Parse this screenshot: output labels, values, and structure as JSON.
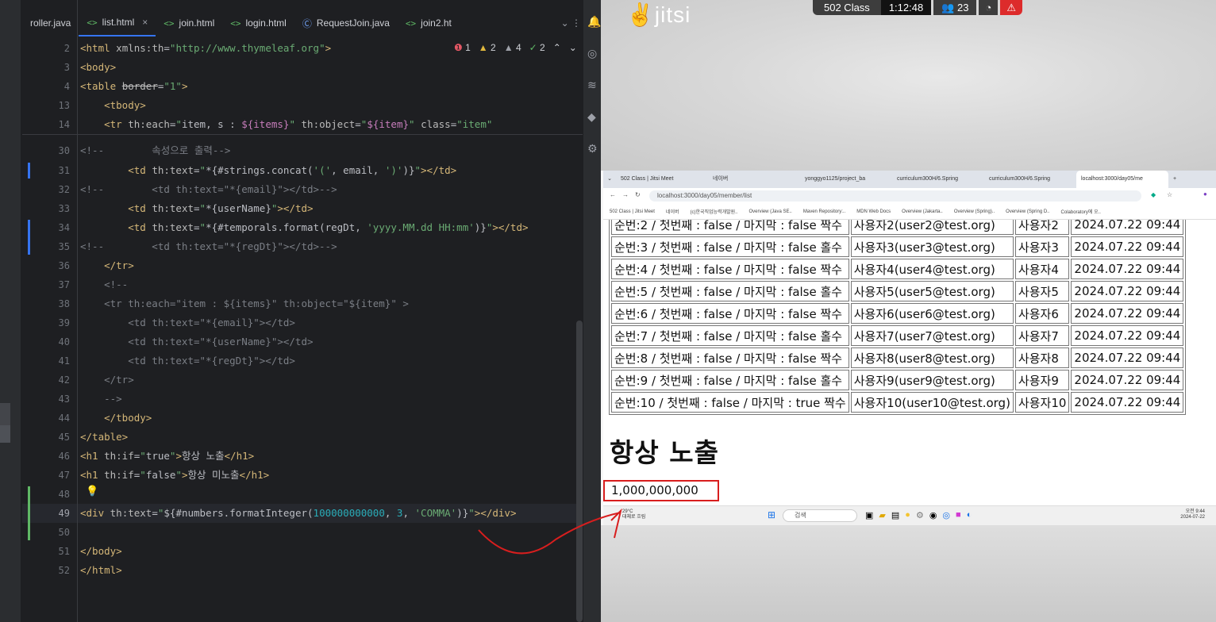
{
  "ide": {
    "tabs": [
      {
        "label": "roller.java",
        "icon": "java-class-icon",
        "closable": false
      },
      {
        "label": "list.html",
        "icon": "html-file-icon",
        "closable": true,
        "active": true
      },
      {
        "label": "join.html",
        "icon": "html-file-icon",
        "closable": false
      },
      {
        "label": "login.html",
        "icon": "html-file-icon",
        "closable": false
      },
      {
        "label": "RequestJoin.java",
        "icon": "java-class-icon",
        "closable": false
      },
      {
        "label": "join2.ht",
        "icon": "html-file-icon",
        "closable": false
      }
    ],
    "inspections": {
      "errors": "1",
      "warnings": "2",
      "weak_warnings": "4",
      "ok": "2"
    },
    "line_numbers": [
      "2",
      "3",
      "4",
      "13",
      "14",
      "30",
      "31",
      "32",
      "33",
      "34",
      "35",
      "36",
      "37",
      "38",
      "39",
      "40",
      "41",
      "42",
      "43",
      "44",
      "45",
      "46",
      "47",
      "48",
      "49",
      "50",
      "51",
      "52"
    ],
    "code": {
      "l2": "<html xmlns:th=\"http://www.thymeleaf.org\">",
      "l3": "<body>",
      "l4": "<table border=\"1\">",
      "l13": "<tbody>",
      "l14": "<tr th:each=\"item, s : ${items}\" th:object=\"${item}\" class=\"item\"",
      "l30": "<!--        속성으로 출력-->",
      "l31": "<td th:text=\"*{#strings.concat('(', email, ')')}\"></td>",
      "l32": "<!--        <td th:text=\"*{email}\"></td>-->",
      "l33": "<td th:text=\"*{userName}\"></td>",
      "l34": "<td th:text=\"*{#temporals.format(regDt, 'yyyy.MM.dd HH:mm')}\"></td>",
      "l35": "<!--        <td th:text=\"*{regDt}\"></td>-->",
      "l36": "</tr>",
      "l37": "<!--",
      "l38": "<tr th:each=\"item : ${items}\" th:object=\"${item}\" >",
      "l39": "<td th:text=\"*{email}\"></td>",
      "l40": "<td th:text=\"*{userName}\"></td>",
      "l41": "<td th:text=\"*{regDt}\"></td>",
      "l42": "</tr>",
      "l43": "-->",
      "l44": "</tbody>",
      "l45": "</table>",
      "l46": "<h1 th:if=\"true\">항상 노출</h1>",
      "l47": "<h1 th:if=\"false\">항상 미노출</h1>",
      "l49": "<div th:text=\"${#numbers.formatInteger(100000000000, 3, 'COMMA')}\"></div>",
      "l51": "</body>",
      "l52": "</html>"
    }
  },
  "meeting": {
    "logo": "jitsi",
    "room": "502 Class",
    "duration": "1:12:48",
    "participants": "23"
  },
  "browser": {
    "tabs": [
      "502 Class | Jitsi Meet",
      "네이버",
      "yonggyo1125/project_ba",
      "curriculum300H/6.Spring",
      "curriculum300H/6.Spring",
      "localhost:3000/day05/me"
    ],
    "url": "localhost:3000/day05/member/list",
    "bookmarks": [
      "502 Class | Jitsi Meet",
      "네이버",
      "(c)한국직업능력개발원..",
      "Overview (Java SE..",
      "Maven Repository:..",
      "MDN Web Docs",
      "Overview (Jakarta..",
      "Overview (Spring)..",
      "Overview (Spring D..",
      "Colaboratory에 오.."
    ],
    "rows": [
      {
        "info": "순번:2 / 첫번째 : false / 마지막 : false 짝수",
        "email": "사용자2(user2@test.org)",
        "name": "사용자2",
        "date": "2024.07.22 09:44"
      },
      {
        "info": "순번:3 / 첫번째 : false / 마지막 : false 홀수",
        "email": "사용자3(user3@test.org)",
        "name": "사용자3",
        "date": "2024.07.22 09:44"
      },
      {
        "info": "순번:4 / 첫번째 : false / 마지막 : false 짝수",
        "email": "사용자4(user4@test.org)",
        "name": "사용자4",
        "date": "2024.07.22 09:44"
      },
      {
        "info": "순번:5 / 첫번째 : false / 마지막 : false 홀수",
        "email": "사용자5(user5@test.org)",
        "name": "사용자5",
        "date": "2024.07.22 09:44"
      },
      {
        "info": "순번:6 / 첫번째 : false / 마지막 : false 짝수",
        "email": "사용자6(user6@test.org)",
        "name": "사용자6",
        "date": "2024.07.22 09:44"
      },
      {
        "info": "순번:7 / 첫번째 : false / 마지막 : false 홀수",
        "email": "사용자7(user7@test.org)",
        "name": "사용자7",
        "date": "2024.07.22 09:44"
      },
      {
        "info": "순번:8 / 첫번째 : false / 마지막 : false 짝수",
        "email": "사용자8(user8@test.org)",
        "name": "사용자8",
        "date": "2024.07.22 09:44"
      },
      {
        "info": "순번:9 / 첫번째 : false / 마지막 : false 홀수",
        "email": "사용자9(user9@test.org)",
        "name": "사용자9",
        "date": "2024.07.22 09:44"
      },
      {
        "info": "순번:10 / 첫번째 : false / 마지막 : true 짝수",
        "email": "사용자10(user10@test.org)",
        "name": "사용자10",
        "date": "2024.07.22 09:44"
      }
    ],
    "heading": "항상 노출",
    "formatted_number": "1,000,000,000",
    "taskbar": {
      "weather_temp": "29°C",
      "weather_desc": "대체로 흐림",
      "search": "검색",
      "time": "오전 9:44",
      "date": "2024-07-22"
    }
  }
}
